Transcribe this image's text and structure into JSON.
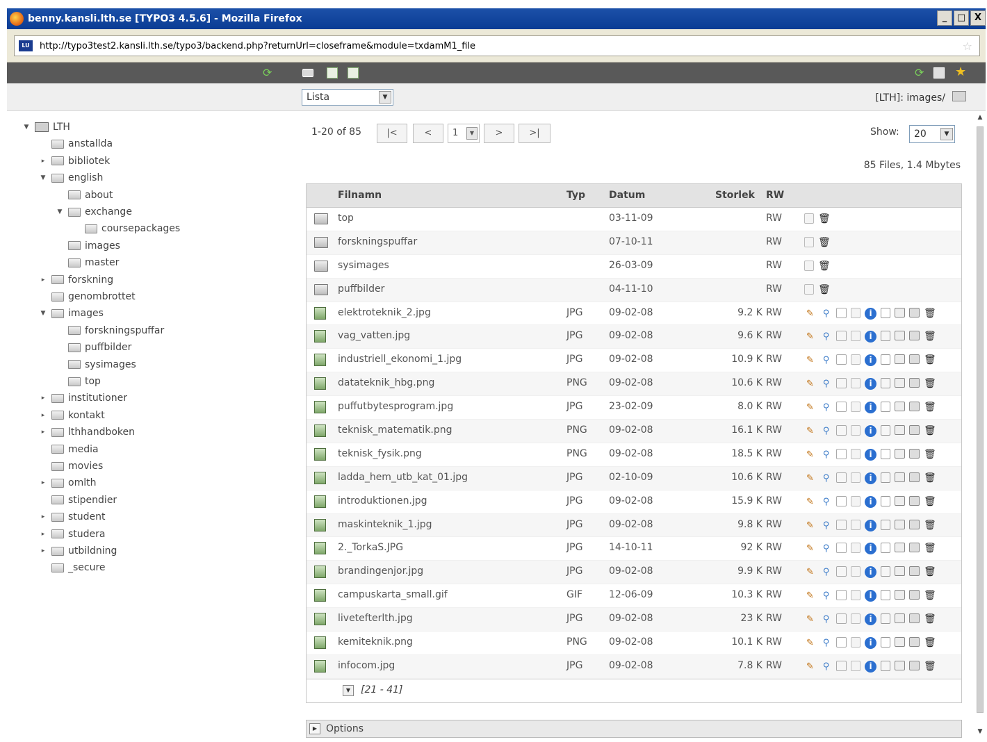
{
  "window": {
    "title": "benny.kansli.lth.se [TYPO3 4.5.6] - Mozilla Firefox",
    "controls": [
      "_",
      "□",
      "X"
    ]
  },
  "browser": {
    "url": "http://typo3test2.kansli.lth.se/typo3/backend.php?returnUrl=closeframe&module=txdamM1_file"
  },
  "toolbar": {
    "view_select": "Lista",
    "path_label": "[LTH]: images/"
  },
  "tree": {
    "nodes": [
      {
        "label": "LTH",
        "level": 0,
        "toggle": "▼",
        "root": true
      },
      {
        "label": "anstallda",
        "level": 1,
        "toggle": ""
      },
      {
        "label": "bibliotek",
        "level": 1,
        "toggle": "▸"
      },
      {
        "label": "english",
        "level": 1,
        "toggle": "▼"
      },
      {
        "label": "about",
        "level": 2,
        "toggle": ""
      },
      {
        "label": "exchange",
        "level": 2,
        "toggle": "▼"
      },
      {
        "label": "coursepackages",
        "level": 3,
        "toggle": ""
      },
      {
        "label": "images",
        "level": 2,
        "toggle": ""
      },
      {
        "label": "master",
        "level": 2,
        "toggle": ""
      },
      {
        "label": "forskning",
        "level": 1,
        "toggle": "▸"
      },
      {
        "label": "genombrottet",
        "level": 1,
        "toggle": ""
      },
      {
        "label": "images",
        "level": 1,
        "toggle": "▼"
      },
      {
        "label": "forskningspuffar",
        "level": 2,
        "toggle": ""
      },
      {
        "label": "puffbilder",
        "level": 2,
        "toggle": ""
      },
      {
        "label": "sysimages",
        "level": 2,
        "toggle": ""
      },
      {
        "label": "top",
        "level": 2,
        "toggle": ""
      },
      {
        "label": "institutioner",
        "level": 1,
        "toggle": "▸"
      },
      {
        "label": "kontakt",
        "level": 1,
        "toggle": "▸"
      },
      {
        "label": "lthhandboken",
        "level": 1,
        "toggle": "▸"
      },
      {
        "label": "media",
        "level": 1,
        "toggle": ""
      },
      {
        "label": "movies",
        "level": 1,
        "toggle": ""
      },
      {
        "label": "omlth",
        "level": 1,
        "toggle": "▸"
      },
      {
        "label": "stipendier",
        "level": 1,
        "toggle": ""
      },
      {
        "label": "student",
        "level": 1,
        "toggle": "▸"
      },
      {
        "label": "studera",
        "level": 1,
        "toggle": "▸"
      },
      {
        "label": "utbildning",
        "level": 1,
        "toggle": "▸"
      },
      {
        "label": "_secure",
        "level": 1,
        "toggle": ""
      }
    ]
  },
  "pager": {
    "range": "1-20 of 85",
    "first": "|<",
    "prev": "<",
    "page": "1",
    "next": ">",
    "last": ">|",
    "show_label": "Show:",
    "show_value": "20",
    "summary": "85 Files, 1.4 Mbytes"
  },
  "table": {
    "headers": {
      "name": "Filnamn",
      "type": "Typ",
      "date": "Datum",
      "size": "Storlek",
      "rw": "RW"
    },
    "rows": [
      {
        "kind": "folder",
        "name": "top",
        "type": "",
        "date": "03-11-09",
        "size": "",
        "rw": "RW"
      },
      {
        "kind": "folder",
        "name": "forskningspuffar",
        "type": "",
        "date": "07-10-11",
        "size": "",
        "rw": "RW"
      },
      {
        "kind": "folder",
        "name": "sysimages",
        "type": "",
        "date": "26-03-09",
        "size": "",
        "rw": "RW"
      },
      {
        "kind": "folder",
        "name": "puffbilder",
        "type": "",
        "date": "04-11-10",
        "size": "",
        "rw": "RW"
      },
      {
        "kind": "file",
        "name": "elektroteknik_2.jpg",
        "type": "JPG",
        "date": "09-02-08",
        "size": "9.2 K",
        "rw": "RW"
      },
      {
        "kind": "file",
        "name": "vag_vatten.jpg",
        "type": "JPG",
        "date": "09-02-08",
        "size": "9.6 K",
        "rw": "RW"
      },
      {
        "kind": "file",
        "name": "industriell_ekonomi_1.jpg",
        "type": "JPG",
        "date": "09-02-08",
        "size": "10.9 K",
        "rw": "RW"
      },
      {
        "kind": "file",
        "name": "datateknik_hbg.png",
        "type": "PNG",
        "date": "09-02-08",
        "size": "10.6 K",
        "rw": "RW"
      },
      {
        "kind": "file",
        "name": "puffutbytesprogram.jpg",
        "type": "JPG",
        "date": "23-02-09",
        "size": "8.0 K",
        "rw": "RW"
      },
      {
        "kind": "file",
        "name": "teknisk_matematik.png",
        "type": "PNG",
        "date": "09-02-08",
        "size": "16.1 K",
        "rw": "RW"
      },
      {
        "kind": "file",
        "name": "teknisk_fysik.png",
        "type": "PNG",
        "date": "09-02-08",
        "size": "18.5 K",
        "rw": "RW"
      },
      {
        "kind": "file",
        "name": "ladda_hem_utb_kat_01.jpg",
        "type": "JPG",
        "date": "02-10-09",
        "size": "10.6 K",
        "rw": "RW"
      },
      {
        "kind": "file",
        "name": "introduktionen.jpg",
        "type": "JPG",
        "date": "09-02-08",
        "size": "15.9 K",
        "rw": "RW"
      },
      {
        "kind": "file",
        "name": "maskinteknik_1.jpg",
        "type": "JPG",
        "date": "09-02-08",
        "size": "9.8 K",
        "rw": "RW"
      },
      {
        "kind": "file",
        "name": "2._TorkaS.JPG",
        "type": "JPG",
        "date": "14-10-11",
        "size": "92 K",
        "rw": "RW"
      },
      {
        "kind": "file",
        "name": "brandingenjor.jpg",
        "type": "JPG",
        "date": "09-02-08",
        "size": "9.9 K",
        "rw": "RW"
      },
      {
        "kind": "file",
        "name": "campuskarta_small.gif",
        "type": "GIF",
        "date": "12-06-09",
        "size": "10.3 K",
        "rw": "RW"
      },
      {
        "kind": "file",
        "name": "livetefterlth.jpg",
        "type": "JPG",
        "date": "09-02-08",
        "size": "23 K",
        "rw": "RW"
      },
      {
        "kind": "file",
        "name": "kemiteknik.png",
        "type": "PNG",
        "date": "09-02-08",
        "size": "10.1 K",
        "rw": "RW"
      },
      {
        "kind": "file",
        "name": "infocom.jpg",
        "type": "JPG",
        "date": "09-02-08",
        "size": "7.8 K",
        "rw": "RW"
      }
    ],
    "more_label": "[21 - 41]"
  },
  "options": {
    "label": "Options"
  },
  "icons": {
    "folder_actions": [
      "info-doc-icon",
      "delete-icon"
    ],
    "file_actions": [
      "edit-icon",
      "view-icon",
      "copy-icon",
      "reference-icon",
      "info-icon",
      "replace-icon",
      "clipboard-icon",
      "move-icon",
      "delete-icon"
    ]
  },
  "colors": {
    "titlebar": "#0a3c94",
    "darkbar": "#595959",
    "info_blue": "#2b6fd0",
    "edit_orange": "#c07010"
  }
}
